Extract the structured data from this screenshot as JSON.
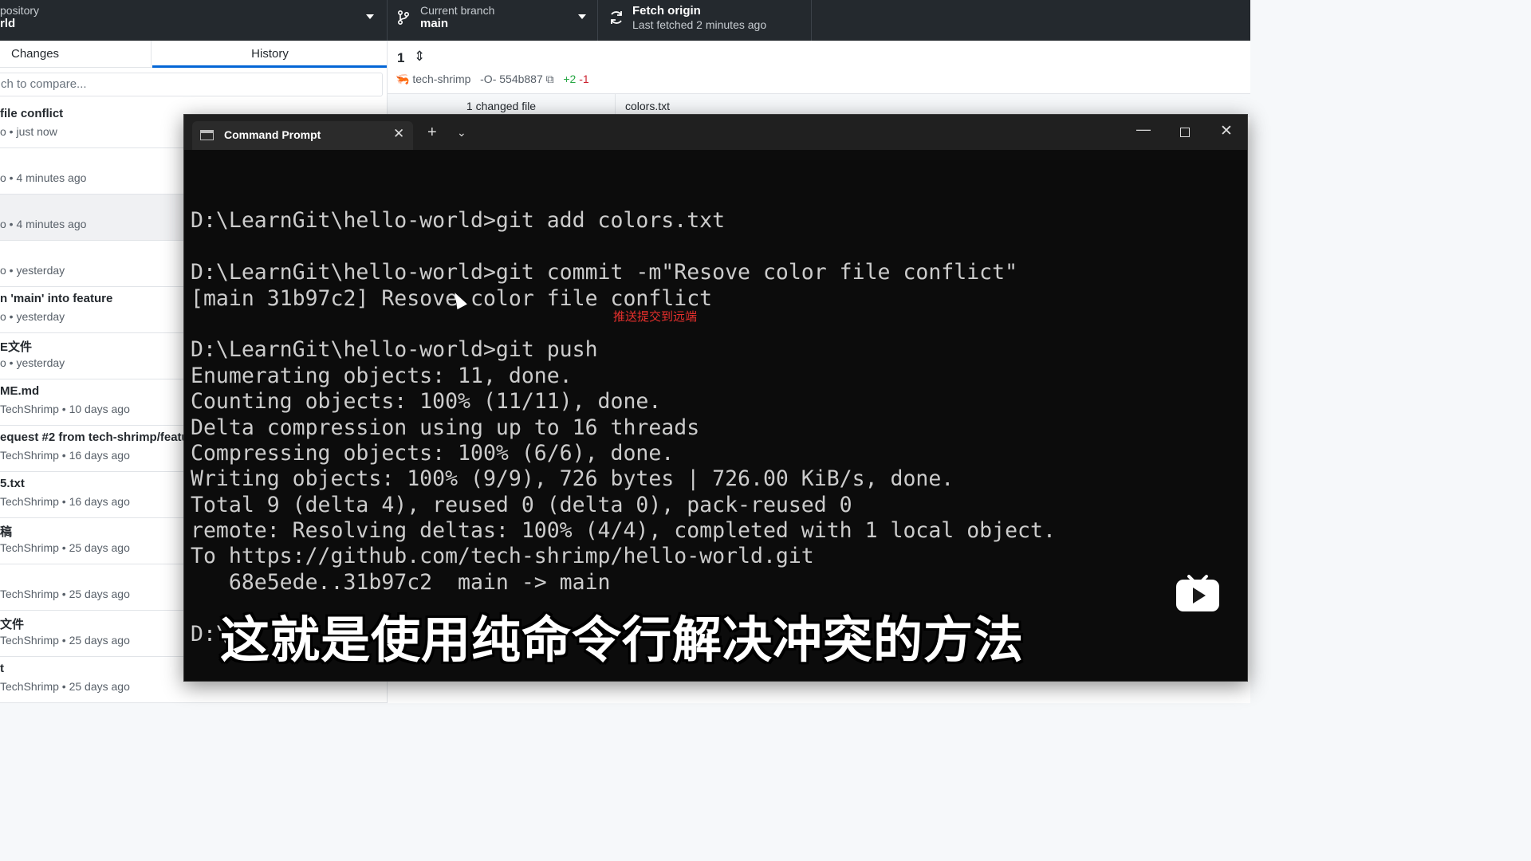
{
  "toolbar": {
    "repo": {
      "label": "pository",
      "value": "rld"
    },
    "branch": {
      "label": "Current branch",
      "value": "main"
    },
    "fetch": {
      "label": "Fetch origin",
      "sub": "Last fetched 2 minutes ago"
    }
  },
  "sidebar": {
    "tabs": {
      "changes": "Changes",
      "history": "History"
    },
    "search_placeholder": "ch to compare...",
    "commits": [
      {
        "title": "file conflict",
        "meta": "o • just now"
      },
      {
        "title": "",
        "meta": "o • 4 minutes ago"
      },
      {
        "title": "",
        "meta": "o • 4 minutes ago",
        "selected": true
      },
      {
        "title": "",
        "meta": "o • yesterday"
      },
      {
        "title": "n 'main' into feature",
        "meta": "o • yesterday"
      },
      {
        "title": "E文件",
        "meta": "o • yesterday"
      },
      {
        "title": "ME.md",
        "meta": "TechShrimp • 10 days ago"
      },
      {
        "title": "equest #2 from tech-shrimp/featu",
        "meta": "TechShrimp • 16 days ago"
      },
      {
        "title": "5.txt",
        "meta": "TechShrimp • 16 days ago"
      },
      {
        "title": "稿",
        "meta": "TechShrimp • 25 days ago"
      },
      {
        "title": "",
        "meta": "TechShrimp • 25 days ago"
      },
      {
        "title": "文件",
        "meta": "TechShrimp • 25 days ago"
      },
      {
        "title": "t",
        "meta": "TechShrimp • 25 days ago"
      }
    ]
  },
  "diff": {
    "number": "1",
    "author": "tech-shrimp",
    "sha": "554b887",
    "additions": "+2",
    "deletions": "-1",
    "changed_files": "1 changed file",
    "file_name": "colors.txt"
  },
  "terminal": {
    "tab_title": "Command Prompt",
    "lines": [
      "",
      "D:\\LearnGit\\hello-world>git add colors.txt",
      "",
      "D:\\LearnGit\\hello-world>git commit -m\"Resove color file conflict\"",
      "[main 31b97c2] Resove color file conflict",
      "",
      "D:\\LearnGit\\hello-world>git push",
      "Enumerating objects: 11, done.",
      "Counting objects: 100% (11/11), done.",
      "Delta compression using up to 16 threads",
      "Compressing objects: 100% (6/6), done.",
      "Writing objects: 100% (9/9), 726 bytes | 726.00 KiB/s, done.",
      "Total 9 (delta 4), reused 0 (delta 0), pack-reused 0",
      "remote: Resolving deltas: 100% (4/4), completed with 1 local object.",
      "To https://github.com/tech-shrimp/hello-world.git",
      "   68e5ede..31b97c2  main -> main",
      "",
      "D:\\"
    ],
    "annotation": "推送提交到远端"
  },
  "subtitle": "这就是使用纯命令行解决冲突的方法",
  "colors": {
    "toolbar_bg": "#24292e",
    "accent": "#0366d6",
    "terminal_bg": "#0c0c0c",
    "annotation": "#e8302d",
    "watermark": "#ffffff"
  }
}
